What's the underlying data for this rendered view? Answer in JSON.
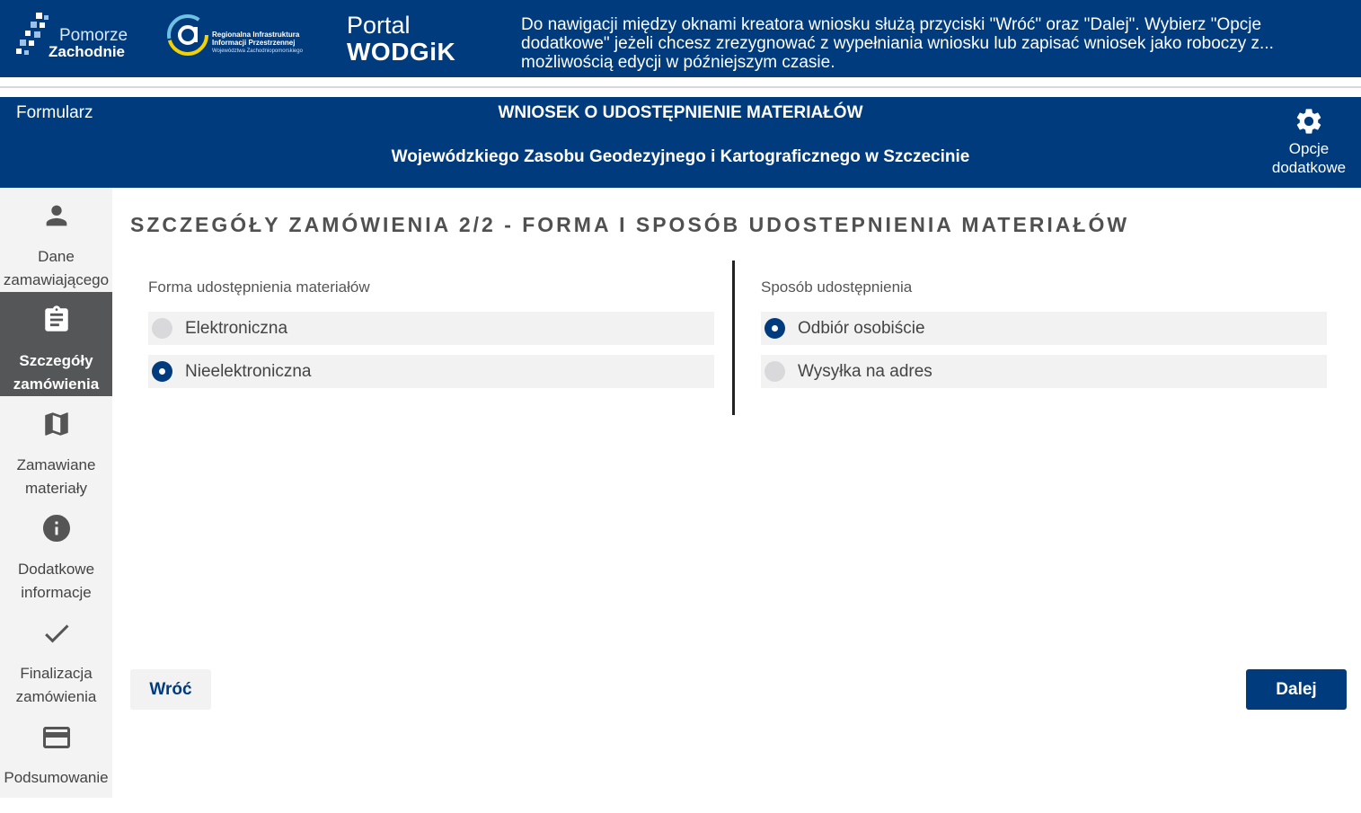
{
  "banner": {
    "logo1_line1": "Pomorze",
    "logo1_line2": "Zachodnie",
    "logo2_line1": "Regionalna Infrastruktura",
    "logo2_line2": "Informacji Przestrzennej",
    "logo2_line3": "Województwa Zachodniopomorskiego",
    "portal_line1": "Portal",
    "portal_line2": "WODGiK",
    "help_text": "Do nawigacji między oknami kreatora wniosku służą przyciski \"Wróć\" oraz \"Dalej\". Wybierz \"Opcje dodatkowe\" jeżeli chcesz zrezygnować z wypełniania wniosku lub zapisać wniosek jako roboczy z... możliwością edycji w późniejszym czasie."
  },
  "header": {
    "form_label": "Formularz",
    "title_line1": "WNIOSEK O UDOSTĘPNIENIE MATERIAŁÓW",
    "title_line2": "Wojewódzkiego Zasobu Geodezyjnego i Kartograficznego w Szczecinie",
    "options_line1": "Opcje",
    "options_line2": "dodatkowe",
    "options_icon": "gear-icon"
  },
  "sidebar": {
    "items": [
      {
        "line1": "Dane",
        "line2": "zamawiającego",
        "icon": "person-icon",
        "active": false
      },
      {
        "line1": "Szczegóły",
        "line2": "zamówienia",
        "icon": "clipboard-icon",
        "active": true
      },
      {
        "line1": "Zamawiane",
        "line2": "materiały",
        "icon": "map-icon",
        "active": false
      },
      {
        "line1": "Dodatkowe",
        "line2": "informacje",
        "icon": "info-icon",
        "active": false
      },
      {
        "line1": "Finalizacja",
        "line2": "zamówienia",
        "icon": "check-icon",
        "active": false
      },
      {
        "line1": "Podsumowanie",
        "line2": "",
        "icon": "credit-card-icon",
        "active": false
      }
    ]
  },
  "main": {
    "section_title": "SZCZEGÓŁY ZAMÓWIENIA 2/2 - FORMA I SPOSÓB UDOSTEPNIENIA MATERIAŁÓW",
    "form_group": {
      "label": "Forma udostępnienia materiałów",
      "options": [
        {
          "label": "Elektroniczna",
          "selected": false
        },
        {
          "label": "Nieelektroniczna",
          "selected": true
        }
      ]
    },
    "method_group": {
      "label": "Sposób udostępnienia",
      "options": [
        {
          "label": "Odbiór osobiście",
          "selected": true
        },
        {
          "label": "Wysyłka na adres",
          "selected": false
        }
      ]
    },
    "back_label": "Wróć",
    "next_label": "Dalej"
  },
  "colors": {
    "brand_blue": "#003b7e",
    "sidebar_bg": "#f3f3f4",
    "sidebar_active": "#555658"
  }
}
